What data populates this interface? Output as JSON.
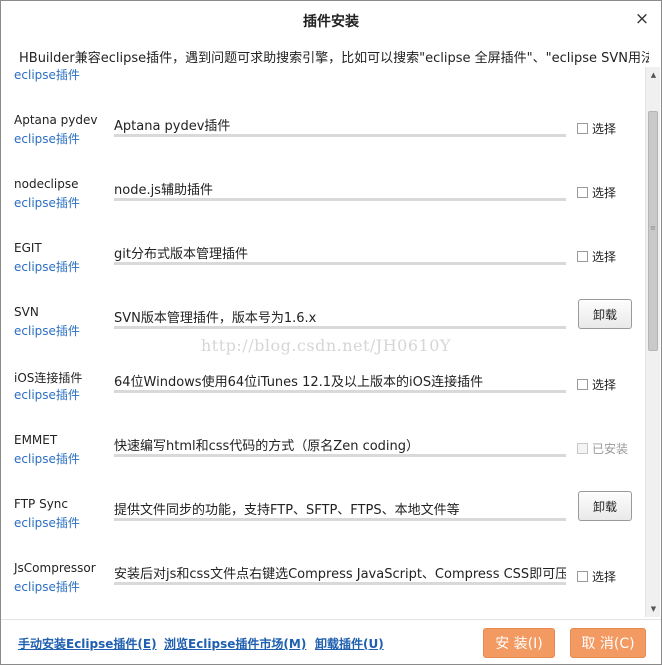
{
  "dialog": {
    "title": "插件安装",
    "close_icon": "×",
    "subtitle": "HBuilder兼容eclipse插件，遇到问题可求助搜索引擎，比如可以搜索\"eclipse 全屏插件\"、\"eclipse SVN用法\""
  },
  "list": {
    "partial_link": "eclipse插件",
    "plugins": [
      {
        "name": "Aptana pydev",
        "link": "eclipse插件",
        "desc": "Aptana pydev插件",
        "action": "checkbox",
        "label": "选择"
      },
      {
        "name": "nodeclipse",
        "link": "eclipse插件",
        "desc": "node.js辅助插件",
        "action": "checkbox",
        "label": "选择"
      },
      {
        "name": "EGIT",
        "link": "eclipse插件",
        "desc": "git分布式版本管理插件",
        "action": "checkbox",
        "label": "选择"
      },
      {
        "name": "SVN",
        "link": "eclipse插件",
        "desc": "SVN版本管理插件，版本号为1.6.x",
        "action": "button",
        "label": "卸载"
      },
      {
        "name": "iOS连接插件",
        "link": "eclipse插件",
        "desc": "64位Windows使用64位iTunes 12.1及以上版本的iOS连接插件",
        "action": "checkbox",
        "label": "选择"
      },
      {
        "name": "EMMET",
        "link": "eclipse插件",
        "desc": "快速编写html和css代码的方式（原名Zen coding）",
        "action": "disabled",
        "label": "已安装"
      },
      {
        "name": "FTP Sync",
        "link": "eclipse插件",
        "desc": "提供文件同步的功能，支持FTP、SFTP、FTPS、本地文件等",
        "action": "button",
        "label": "卸载"
      },
      {
        "name": "JsCompressor",
        "link": "eclipse插件",
        "desc": "安装后对js和css文件点右键选Compress JavaScript、Compress CSS即可压缩",
        "action": "checkbox",
        "label": "选择"
      }
    ]
  },
  "watermark": "http://blog.csdn.net/JH0610Y",
  "footer": {
    "manual_install": "手动安装Eclipse插件(E)",
    "browse_market": "浏览Eclipse插件市场(M)",
    "uninstall_plugin": "卸载插件(U)",
    "install_button": "安 装(I)",
    "cancel_button": "取 消(C)"
  },
  "colors": {
    "link": "#2a6fc0",
    "accent": "#f39a62",
    "footer_link": "#1f5fb0"
  },
  "icons": {
    "scroll_up": "scroll-up-arrow-icon",
    "scroll_down": "scroll-down-arrow-icon",
    "close": "close-icon"
  }
}
